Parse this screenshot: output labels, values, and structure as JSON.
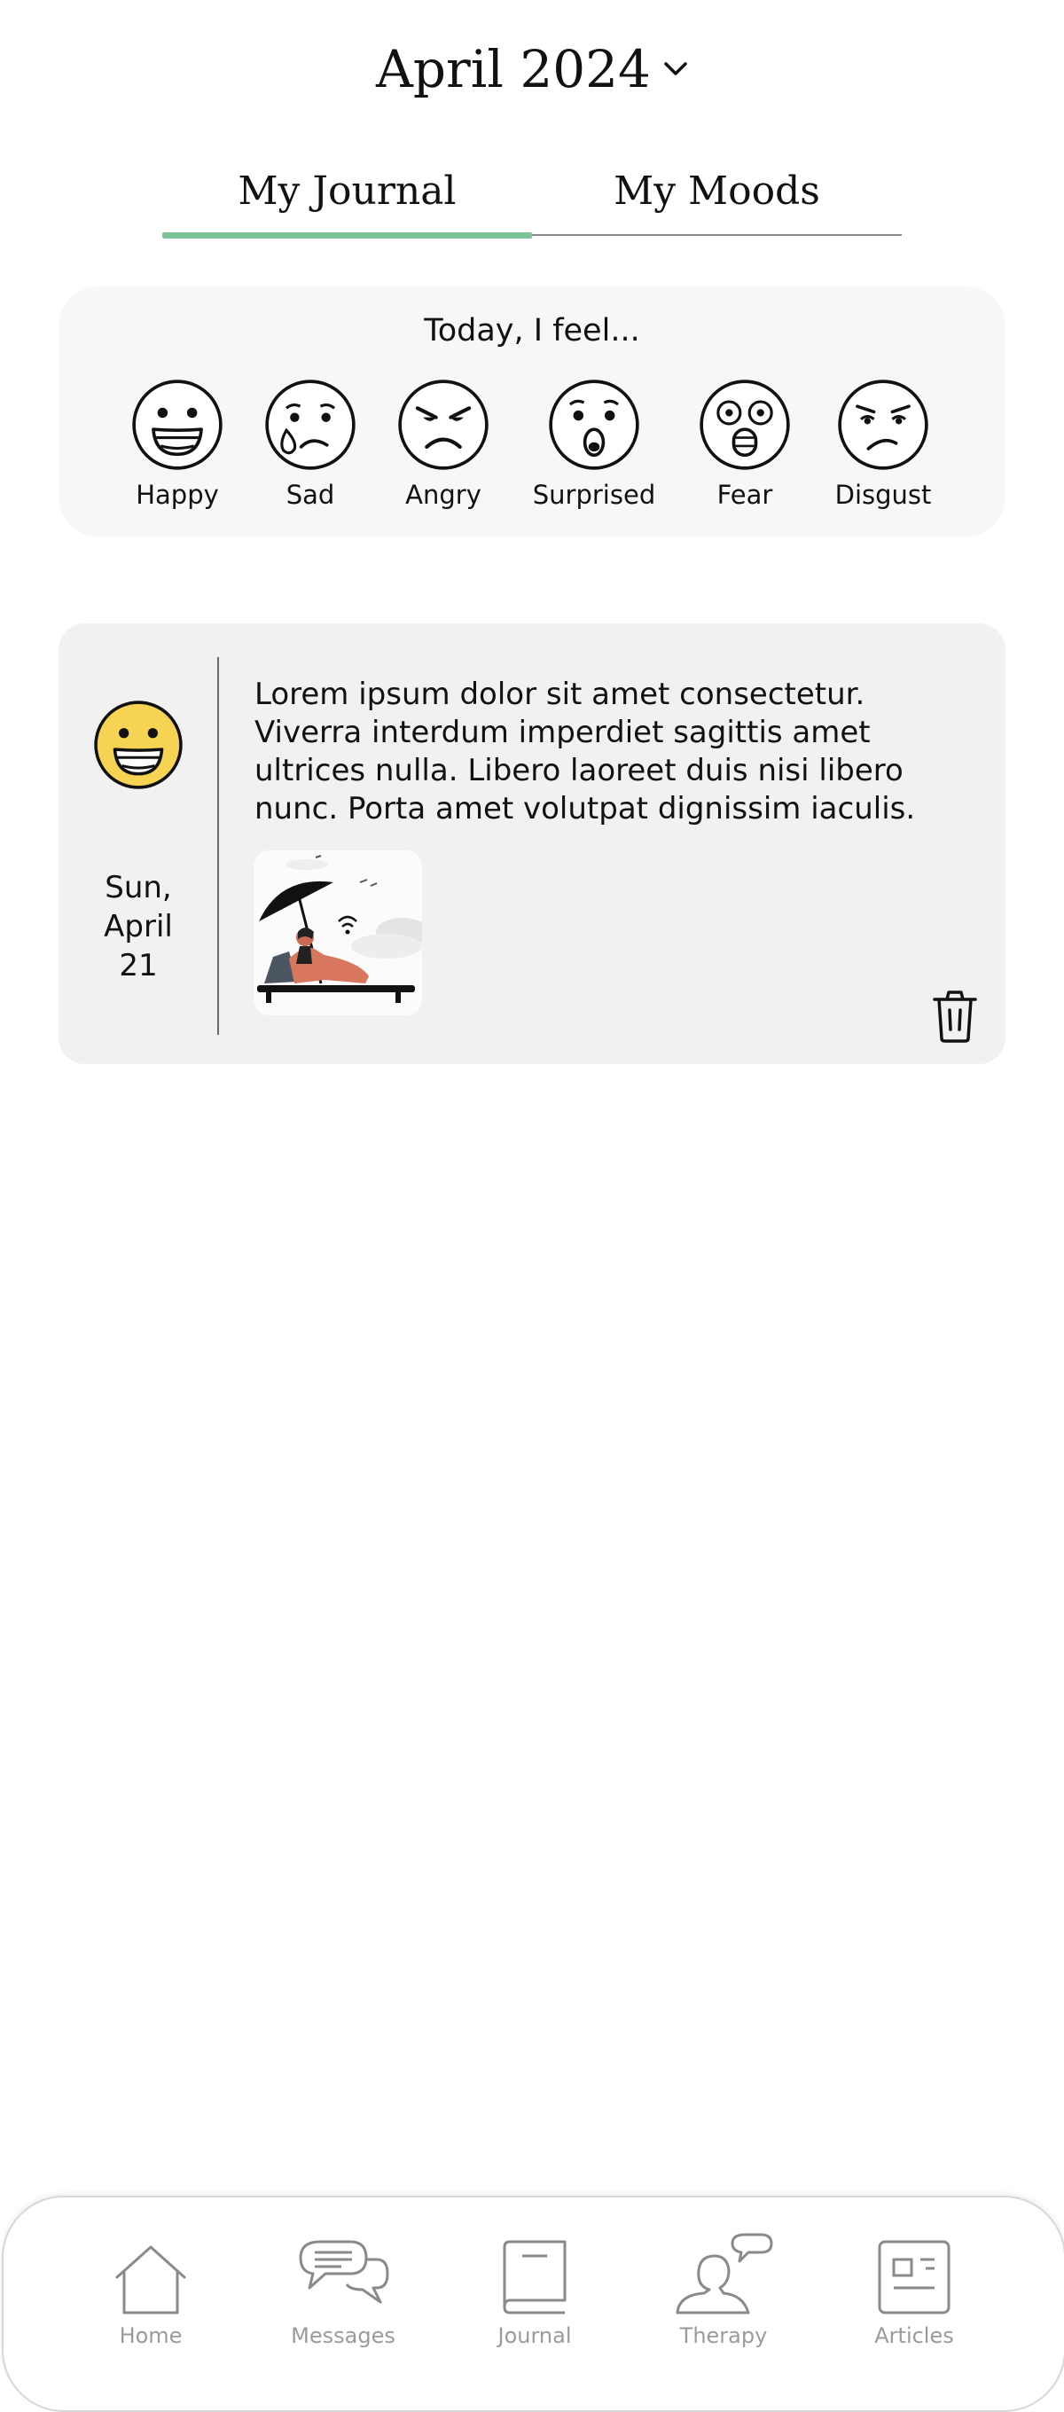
{
  "header": {
    "month_title": "April 2024"
  },
  "tabs": [
    {
      "label": "My Journal",
      "active": true
    },
    {
      "label": "My Moods",
      "active": false
    }
  ],
  "mood_picker": {
    "prompt": "Today, I feel...",
    "options": [
      {
        "label": "Happy",
        "icon": "happy-face-icon"
      },
      {
        "label": "Sad",
        "icon": "sad-face-icon"
      },
      {
        "label": "Angry",
        "icon": "angry-face-icon"
      },
      {
        "label": "Surprised",
        "icon": "surprised-face-icon"
      },
      {
        "label": "Fear",
        "icon": "fear-face-icon"
      },
      {
        "label": "Disgust",
        "icon": "disgust-face-icon"
      }
    ]
  },
  "entry": {
    "mood": "Happy",
    "date_line1": "Sun,",
    "date_line2": "April",
    "date_line3": "21",
    "text": "Lorem ipsum dolor sit amet consectetur. Viverra interdum imperdiet sagittis amet ultrices nulla. Libero laoreet duis nisi libero nunc. Porta amet volutpat dignissim iaculis.",
    "image": "woman-on-sunbed-illustration"
  },
  "bottom_nav": [
    {
      "label": "Home",
      "icon": "home-icon"
    },
    {
      "label": "Messages",
      "icon": "chat-bubbles-icon"
    },
    {
      "label": "Journal",
      "icon": "book-icon"
    },
    {
      "label": "Therapy",
      "icon": "person-speech-icon"
    },
    {
      "label": "Articles",
      "icon": "newspaper-icon"
    }
  ],
  "colors": {
    "accent": "#7cc398",
    "mood_card_bg": "#f7f7f7",
    "entry_card_bg": "#f1f1f1",
    "happy_yellow": "#f7d354",
    "nav_gray": "#9b9b9b"
  }
}
